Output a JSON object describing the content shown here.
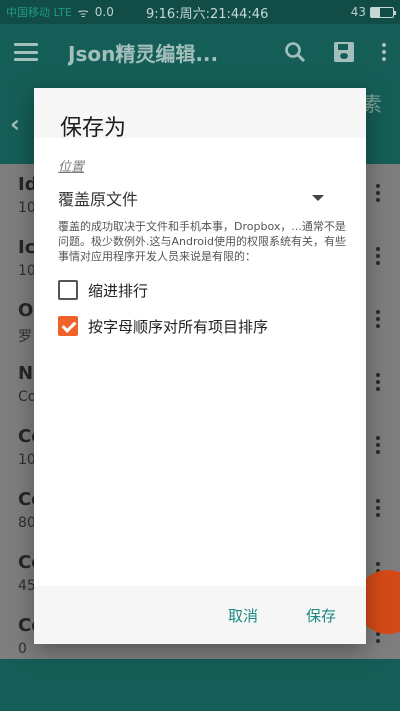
{
  "status_bar": {
    "signal": "中国移动 LTE",
    "wifi": "ᯤ",
    "speed": "0.0",
    "time": "9:16:周六:21:44:46",
    "battery": "43",
    "battery_level": 0.43
  },
  "app_bar": {
    "title": "Json精灵编辑..."
  },
  "sub_bar": {
    "right_text": "素"
  },
  "list_items": [
    {
      "key": "Id",
      "value": "10"
    },
    {
      "key": "Ic",
      "value": "10"
    },
    {
      "key": "Ol",
      "value": "罗"
    },
    {
      "key": "Na",
      "value": "Co"
    },
    {
      "key": "Co",
      "value": "10"
    },
    {
      "key": "Co",
      "value": "80"
    },
    {
      "key": "Co",
      "value": "45"
    },
    {
      "key": "Co",
      "value": "0"
    }
  ],
  "dialog": {
    "title": "保存为",
    "section_label": "位置",
    "select_value": "覆盖原文件",
    "description": "覆盖的成功取决于文件和手机本事，Dropbox，...通常不是问题。极少数例外.这与Android使用的权限系统有关，有些事情对应用程序开发人员来说是有限的：",
    "checkbox_indent": {
      "label": "缩进排行",
      "checked": false
    },
    "checkbox_sort": {
      "label": "按字母顺序对所有项目排序",
      "checked": true
    },
    "cancel_label": "取消",
    "save_label": "保存"
  }
}
